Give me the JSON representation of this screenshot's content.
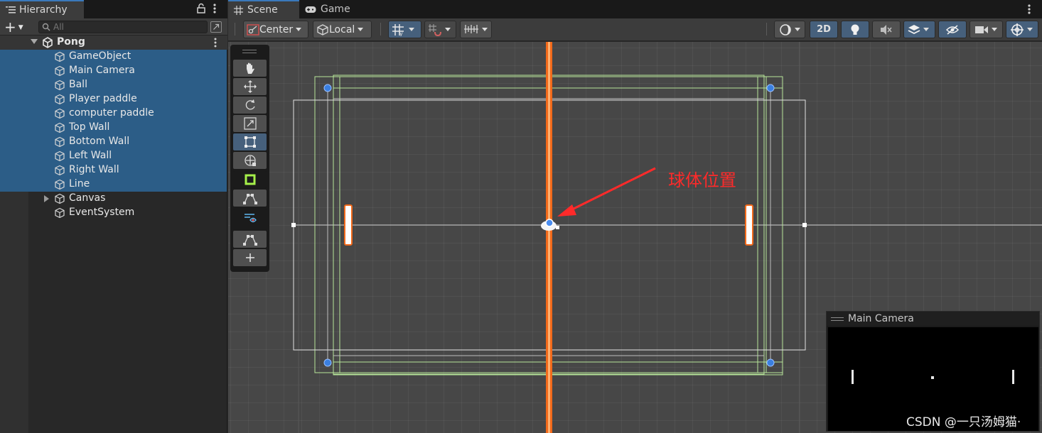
{
  "hierarchy": {
    "tab_label": "Hierarchy",
    "search_placeholder": "All",
    "add_label": "+",
    "scene_name": "Pong",
    "items": [
      {
        "label": "GameObject"
      },
      {
        "label": "Main Camera"
      },
      {
        "label": "Ball"
      },
      {
        "label": "Player paddle"
      },
      {
        "label": "computer paddle"
      },
      {
        "label": "Top Wall"
      },
      {
        "label": "Bottom Wall"
      },
      {
        "label": "Left Wall"
      },
      {
        "label": "Right Wall"
      },
      {
        "label": "Line"
      },
      {
        "label": "Canvas"
      },
      {
        "label": "EventSystem"
      }
    ]
  },
  "scene": {
    "tabs": [
      {
        "label": "Scene"
      },
      {
        "label": "Game"
      }
    ],
    "toolbar": {
      "pivot_label": "Center",
      "space_label": "Local",
      "mode_2d_label": "2D"
    },
    "camera_preview_title": "Main Camera",
    "annotation_text": "球体位置",
    "watermark_text": "CSDN @一只汤姆猫·"
  },
  "colors": {
    "accent": "#3a79bb",
    "selection": "#2c5d87",
    "line_orange": "#f26a1b",
    "bounds_green": "#b7e69a",
    "annotation_red": "#ff2a2a"
  }
}
